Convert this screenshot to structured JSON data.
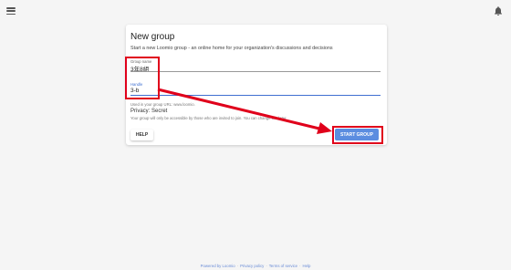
{
  "form": {
    "title": "New group",
    "description": "Start a new Loomio group - an online home for your organization's discussions and decisions",
    "group_name_label": "Group name",
    "group_name_value": "3年8組",
    "handle_label": "Handle",
    "handle_value": "3-b",
    "handle_helper": "Used in your group URL: www.loomio.",
    "privacy_title": "Privacy: Secret",
    "privacy_desc": "Your group will only be accessible by those who are invited to join. You can change this later.",
    "help_label": "HELP",
    "start_label": "START GROUP"
  },
  "footer": {
    "powered_by": "Powered by Loomio",
    "privacy_policy": "Privacy policy",
    "terms": "Terms of service",
    "help": "Help"
  },
  "colors": {
    "primary": "#5b8de0",
    "annotation": "#e0001b"
  }
}
